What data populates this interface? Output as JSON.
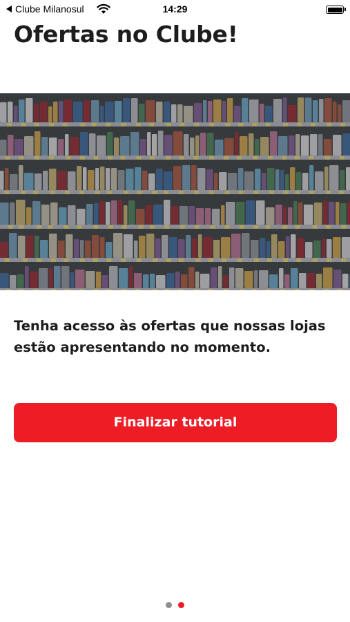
{
  "status_bar": {
    "back_app": "Clube Milanosul",
    "time": "14:29"
  },
  "page": {
    "title": "Ofertas no Clube!",
    "description_line1": "Tenha acesso às ofertas que nossas lojas",
    "description_line2": "estão apresentando no momento.",
    "cta_label": "Finalizar tutorial"
  },
  "hero_image": {
    "subject": "supermarket-shelves"
  },
  "pagination": {
    "total": 2,
    "active": 2
  },
  "colors": {
    "accent": "#ee1c25",
    "text": "#1d1d1f",
    "inactive_dot": "#8e8e93"
  }
}
